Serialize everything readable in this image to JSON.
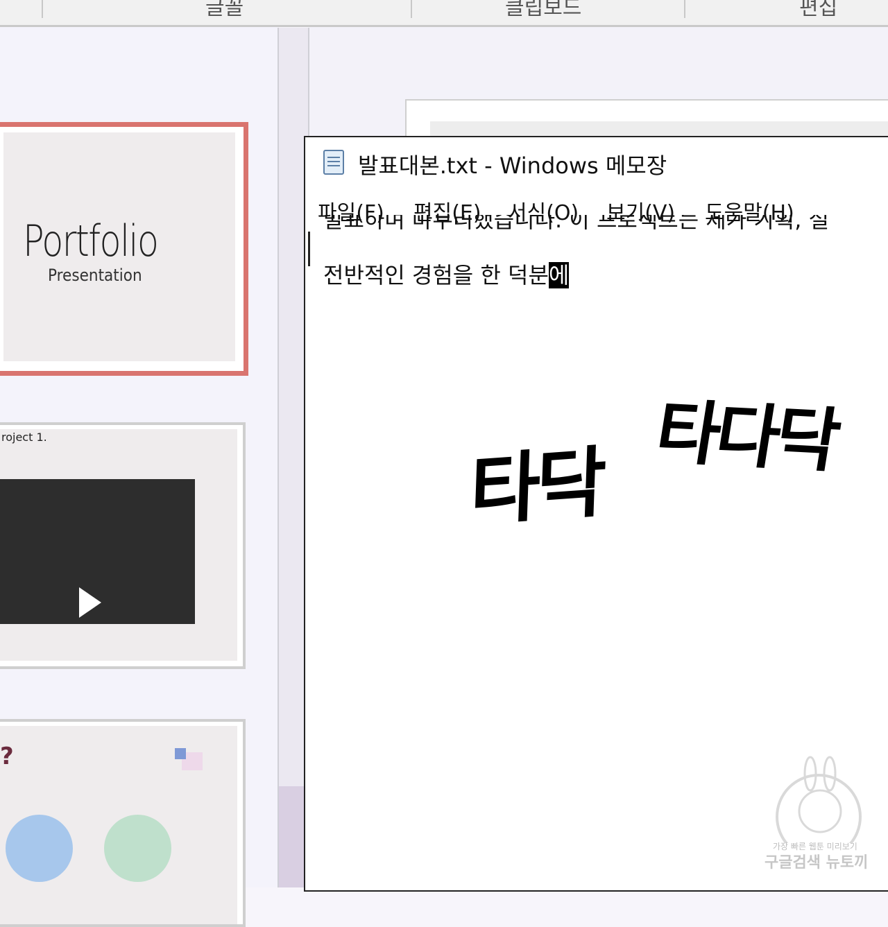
{
  "ribbon": {
    "groups": [
      "글꼴",
      "클립보드",
      "편집"
    ]
  },
  "slides": {
    "slide1": {
      "title": "Portfolio",
      "subtitle": "Presentation"
    },
    "slide2": {
      "label": "roject 1.",
      "play_icon": "play-icon"
    },
    "slide3": {
      "heading": "?"
    }
  },
  "notepad": {
    "title": "발표대본.txt - Windows 메모장",
    "menu": [
      "파일(F)",
      "편집(E)",
      "서식(O)",
      "보기(V)",
      "도움말(H)"
    ],
    "line1": "발표하며 마무리했습니다. 이 프로젝트는 제가 기획, 설",
    "line2": "전반적인 경험을 한 덕분",
    "line2_selected": "에"
  },
  "sound_effects": [
    "타닥",
    "타다닥"
  ],
  "watermark": {
    "small": "가장 빠른 웹툰 미리보기",
    "big": "구글검색 뉴토끼"
  },
  "colors": {
    "selected_slide_border": "#d9746f",
    "video_bg": "#2d2d2d",
    "circle_blue": "#a7c7ec",
    "circle_green": "#bfe0cc"
  }
}
